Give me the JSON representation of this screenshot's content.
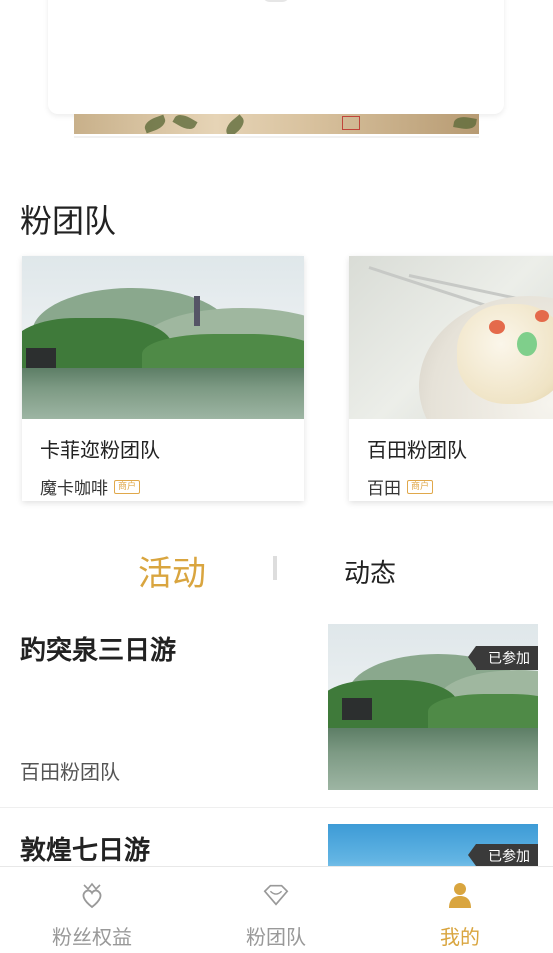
{
  "section_title": "粉团队",
  "teams": [
    {
      "name": "卡菲迩粉团队",
      "owner": "魔卡咖啡",
      "badge": "商户",
      "image": "lake-photo"
    },
    {
      "name": "百田粉团队",
      "owner": "百田",
      "badge": "商户",
      "image": "dessert-photo"
    }
  ],
  "tabs": [
    {
      "label": "活动",
      "active": true
    },
    {
      "label": "动态",
      "active": false
    }
  ],
  "activities": [
    {
      "title": "趵突泉三日游",
      "team": "百田粉团队",
      "status": "已参加",
      "image": "lake-photo"
    },
    {
      "title": "敦煌七日游",
      "team": "",
      "status": "已参加",
      "image": "sky-photo"
    }
  ],
  "nav": [
    {
      "label": "粉丝权益",
      "icon": "crown-heart-icon",
      "active": false
    },
    {
      "label": "粉团队",
      "icon": "diamond-icon",
      "active": false
    },
    {
      "label": "我的",
      "icon": "user-icon",
      "active": true
    }
  ],
  "colors": {
    "accent": "#d9a53f",
    "inactive": "#999999"
  }
}
